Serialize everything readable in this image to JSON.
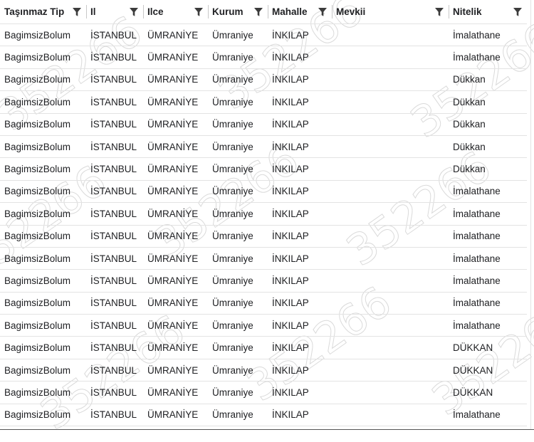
{
  "columns": [
    {
      "key": "tip",
      "label": "Taşınmaz Tip"
    },
    {
      "key": "il",
      "label": "Il"
    },
    {
      "key": "ilce",
      "label": "Ilce"
    },
    {
      "key": "kurum",
      "label": "Kurum"
    },
    {
      "key": "mahalle",
      "label": "Mahalle"
    },
    {
      "key": "mevkii",
      "label": "Mevkii"
    },
    {
      "key": "nitelik",
      "label": "Nitelik"
    }
  ],
  "rows": [
    [
      "BagimsizBolum",
      "İSTANBUL",
      "ÜMRANİYE",
      "Ümraniye",
      "İNKILAP",
      "",
      "İmalathane"
    ],
    [
      "BagimsizBolum",
      "İSTANBUL",
      "ÜMRANİYE",
      "Ümraniye",
      "İNKILAP",
      "",
      "İmalathane"
    ],
    [
      "BagimsizBolum",
      "İSTANBUL",
      "ÜMRANİYE",
      "Ümraniye",
      "İNKILAP",
      "",
      "Dükkan"
    ],
    [
      "BagimsizBolum",
      "İSTANBUL",
      "ÜMRANİYE",
      "Ümraniye",
      "İNKILAP",
      "",
      "Dükkan"
    ],
    [
      "BagimsizBolum",
      "İSTANBUL",
      "ÜMRANİYE",
      "Ümraniye",
      "İNKILAP",
      "",
      "Dükkan"
    ],
    [
      "BagimsizBolum",
      "İSTANBUL",
      "ÜMRANİYE",
      "Ümraniye",
      "İNKILAP",
      "",
      "Dükkan"
    ],
    [
      "BagimsizBolum",
      "İSTANBUL",
      "ÜMRANİYE",
      "Ümraniye",
      "İNKILAP",
      "",
      "Dükkan"
    ],
    [
      "BagimsizBolum",
      "İSTANBUL",
      "ÜMRANİYE",
      "Ümraniye",
      "İNKILAP",
      "",
      "İmalathane"
    ],
    [
      "BagimsizBolum",
      "İSTANBUL",
      "ÜMRANİYE",
      "Ümraniye",
      "İNKILAP",
      "",
      "İmalathane"
    ],
    [
      "BagimsizBolum",
      "İSTANBUL",
      "ÜMRANİYE",
      "Ümraniye",
      "İNKILAP",
      "",
      "İmalathane"
    ],
    [
      "BagimsizBolum",
      "İSTANBUL",
      "ÜMRANİYE",
      "Ümraniye",
      "İNKILAP",
      "",
      "İmalathane"
    ],
    [
      "BagimsizBolum",
      "İSTANBUL",
      "ÜMRANİYE",
      "Ümraniye",
      "İNKILAP",
      "",
      "İmalathane"
    ],
    [
      "BagimsizBolum",
      "İSTANBUL",
      "ÜMRANİYE",
      "Ümraniye",
      "İNKILAP",
      "",
      "İmalathane"
    ],
    [
      "BagimsizBolum",
      "İSTANBUL",
      "ÜMRANİYE",
      "Ümraniye",
      "İNKILAP",
      "",
      "İmalathane"
    ],
    [
      "BagimsizBolum",
      "İSTANBUL",
      "ÜMRANİYE",
      "Ümraniye",
      "İNKILAP",
      "",
      "DÜKKAN"
    ],
    [
      "BagimsizBolum",
      "İSTANBUL",
      "ÜMRANİYE",
      "Ümraniye",
      "İNKILAP",
      "",
      "DÜKKAN"
    ],
    [
      "BagimsizBolum",
      "İSTANBUL",
      "ÜMRANİYE",
      "Ümraniye",
      "İNKILAP",
      "",
      "DÜKKAN"
    ],
    [
      "BagimsizBolum",
      "İSTANBUL",
      "ÜMRANİYE",
      "Ümraniye",
      "İNKILAP",
      "",
      "İmalathane"
    ]
  ],
  "watermark": {
    "text": "352266",
    "color": "#bdbdbd"
  },
  "colors": {
    "text": "#202124",
    "grid_line": "#e3e3e3",
    "filter_icon": "#3c3c3c"
  }
}
